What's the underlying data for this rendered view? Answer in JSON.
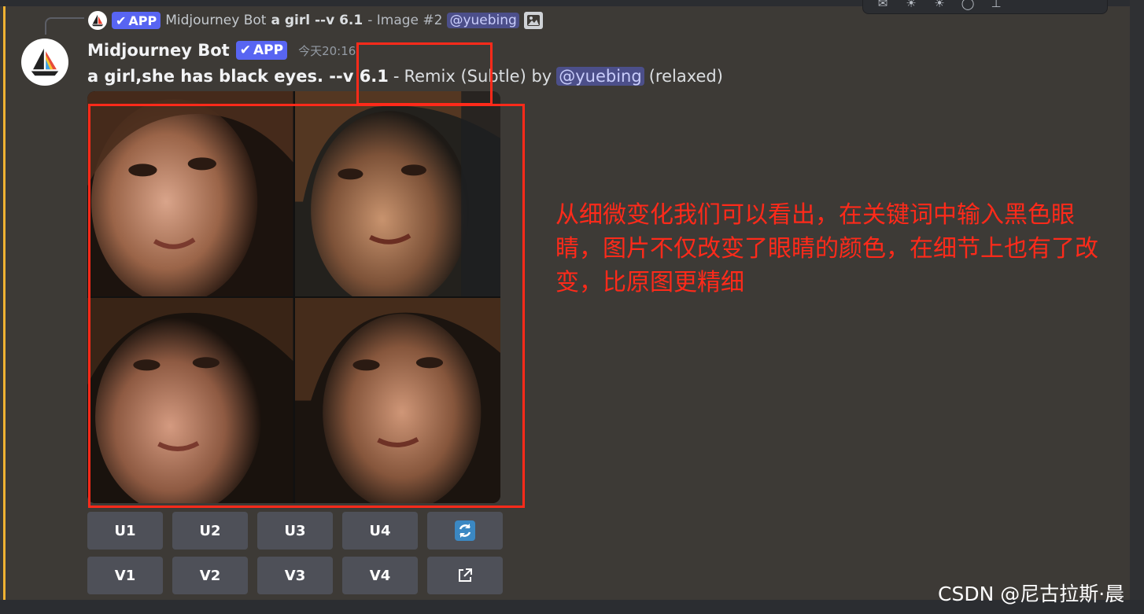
{
  "reply": {
    "author": "Midjourney Bot",
    "app_badge": "APP",
    "prompt": "a girl --v 6.1",
    "suffix": "- Image #2",
    "mention": "@yuebing"
  },
  "message": {
    "author": "Midjourney Bot",
    "app_badge": "APP",
    "timestamp": "今天20:16",
    "prompt_bold": "a girl,she has black eyes. --v 6.1",
    "separator": "-",
    "remix_text": "Remix (Subtle) by",
    "mention": "@yuebing",
    "mode": "(relaxed)"
  },
  "image_grid": {
    "tiles": [
      "girl-portrait-1",
      "girl-portrait-2",
      "girl-portrait-3",
      "girl-portrait-4"
    ]
  },
  "buttons": {
    "row1": [
      "U1",
      "U2",
      "U3",
      "U4"
    ],
    "row1_icon": "refresh-icon",
    "row2": [
      "V1",
      "V2",
      "V3",
      "V4"
    ],
    "row2_icon": "open-external-icon"
  },
  "annotation": {
    "line1": "从细微变化我们可以看出，在关键词中输入黑色眼",
    "line2": "睛，图片不仅改变了眼睛的颜色，在细节上也有了改",
    "line3": "变，比原图更精细"
  },
  "watermark": "CSDN @尼古拉斯·晨",
  "colors": {
    "accent_bar": "#f0b232",
    "app_badge": "#5865f2",
    "annotation_red": "#ff2a1a",
    "button_bg": "#4e5058",
    "background": "#3d3a36"
  }
}
